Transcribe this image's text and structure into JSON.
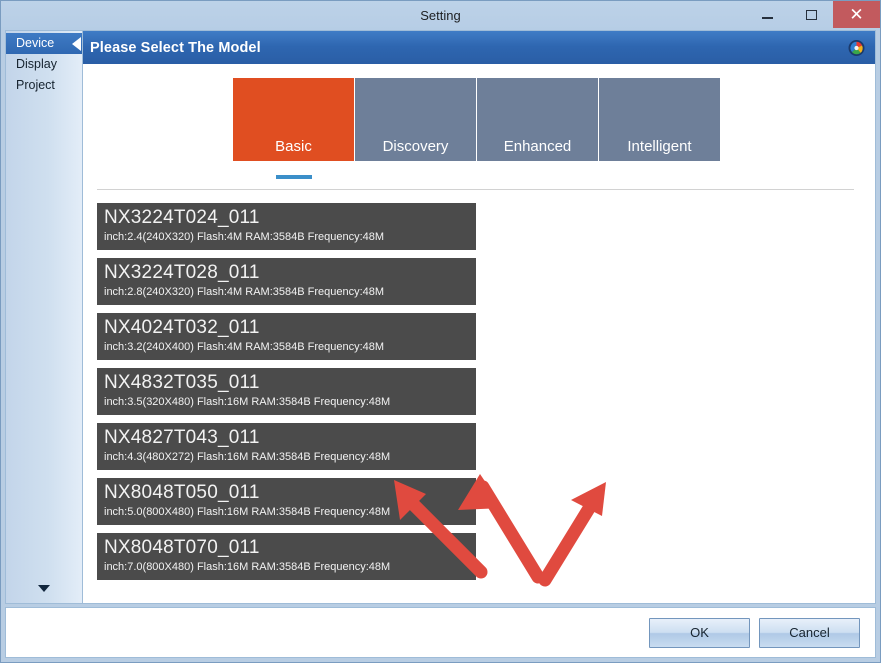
{
  "window": {
    "title": "Setting",
    "controls": {
      "minimize": "minimize-icon",
      "maximize": "maximize-icon",
      "close": "✕"
    }
  },
  "sidebar": {
    "items": [
      {
        "label": "Device",
        "active": true
      },
      {
        "label": "Display",
        "active": false
      },
      {
        "label": "Project",
        "active": false
      }
    ],
    "scroll_down_icon": "chevron-down-icon"
  },
  "panel": {
    "header_title": "Please Select The Model",
    "brand_logo_icon": "brand-logo-icon"
  },
  "tabs": [
    {
      "label": "Basic",
      "selected": true
    },
    {
      "label": "Discovery",
      "selected": false
    },
    {
      "label": "Enhanced",
      "selected": false
    },
    {
      "label": "Intelligent",
      "selected": false
    }
  ],
  "models": [
    {
      "name": "NX3224T024_011",
      "spec": "inch:2.4(240X320) Flash:4M RAM:3584B Frequency:48M"
    },
    {
      "name": "NX3224T028_011",
      "spec": "inch:2.8(240X320) Flash:4M RAM:3584B Frequency:48M"
    },
    {
      "name": "NX4024T032_011",
      "spec": "inch:3.2(240X400) Flash:4M RAM:3584B Frequency:48M"
    },
    {
      "name": "NX4832T035_011",
      "spec": "inch:3.5(320X480) Flash:16M RAM:3584B Frequency:48M"
    },
    {
      "name": "NX4827T043_011",
      "spec": "inch:4.3(480X272) Flash:16M RAM:3584B Frequency:48M"
    },
    {
      "name": "NX8048T050_011",
      "spec": "inch:5.0(800X480) Flash:16M RAM:3584B Frequency:48M"
    },
    {
      "name": "NX8048T070_011",
      "spec": "inch:7.0(800X480) Flash:16M RAM:3584B Frequency:48M"
    }
  ],
  "annotations": {
    "arrows": [
      {
        "name": "arrow-up-left",
        "direction": "up-left"
      },
      {
        "name": "arrow-up",
        "direction": "up"
      },
      {
        "name": "arrow-up-right",
        "direction": "up-right"
      }
    ],
    "color": "#e04a3f"
  },
  "footer": {
    "ok_label": "OK",
    "cancel_label": "Cancel"
  },
  "colors": {
    "accent_selected_tab": "#e04e21",
    "tab_default": "#6e7f99",
    "tab_indicator": "#3b8fc9",
    "panel_header": "#2e66b0",
    "card_background": "#4b4b4b",
    "close_button": "#c25a5e",
    "annotation_red": "#e04a3f"
  }
}
